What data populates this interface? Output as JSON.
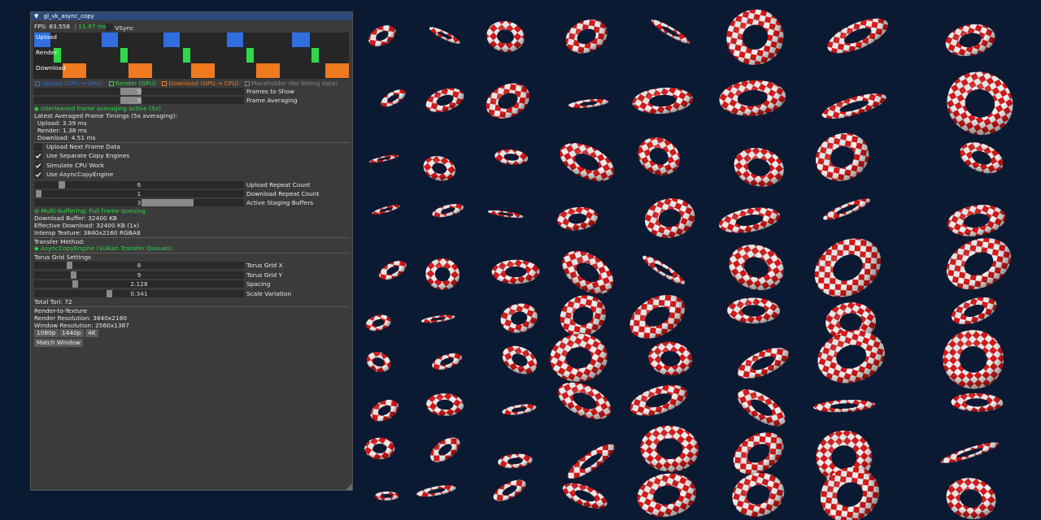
{
  "window": {
    "title": "gl_vk_async_copy"
  },
  "stats": {
    "fps": "FPS: 83.558",
    "frame_ms": "| 11.97 ms",
    "vsync_label": "VSync"
  },
  "timeline": {
    "lanes": [
      "Upload",
      "Render",
      "Download"
    ],
    "legend": [
      {
        "label": "Upload (CPU → GPU)",
        "color": "#2f6fe0"
      },
      {
        "label": "Render (GPU)",
        "color": "#2ed84a"
      },
      {
        "label": "Download (GPU → CPU)",
        "color": "#f07a20"
      },
      {
        "label": "Placeholder (No timing data)",
        "color": "#888888"
      }
    ]
  },
  "frames_to_show": {
    "value": "5",
    "label": "Frames to Show"
  },
  "frame_averaging": {
    "value": "5",
    "label": "Frame Averaging"
  },
  "averaging_status": "Interleaved frame averaging active (5x)",
  "timings": {
    "heading": "Latest Averaged Frame Timings (5x averaging):",
    "upload": "Upload: 3.39 ms",
    "render": "Render: 1.38 ms",
    "download": "Download: 4.51 ms"
  },
  "checkboxes": [
    {
      "label": "Upload Next Frame Data",
      "checked": false
    },
    {
      "label": "Use Separate Copy Engines",
      "checked": true
    },
    {
      "label": "Simulate CPU Work",
      "checked": true
    },
    {
      "label": "Use AsyncCopyEngine",
      "checked": true
    }
  ],
  "upload_repeat": {
    "value": "6",
    "label": "Upload Repeat Count"
  },
  "download_repeat": {
    "value": "1",
    "label": "Download Repeat Count"
  },
  "staging_buffers": {
    "value": "3",
    "label": "Active Staging Buffers"
  },
  "buffering_status": "Multi-buffering: Full frame queuing",
  "buffer_info": {
    "download_buffer": "Download Buffer: 32400 KB",
    "effective_download": "Effective Download: 32400 KB (1x)",
    "interop_texture": "Interop Texture: 3840x2160 RGBA8"
  },
  "transfer": {
    "heading": "Transfer Method:",
    "method": "AsyncCopyEngine (Vulkan Transfer Queues)"
  },
  "torus": {
    "heading": "Torus Grid Settings",
    "grid_x": {
      "value": "8",
      "label": "Torus Grid X"
    },
    "grid_y": {
      "value": "9",
      "label": "Torus Grid Y"
    },
    "spacing": {
      "value": "2.128",
      "label": "Spacing"
    },
    "scale_variation": {
      "value": "0.341",
      "label": "Scale Variation"
    },
    "total": "Total Tori: 72"
  },
  "render_target": {
    "heading": "Render-to-Texture",
    "render_resolution": "Render Resolution: 3840x2160",
    "window_resolution": "Window Resolution: 2560x1387",
    "buttons": [
      "1080p",
      "1440p",
      "4K"
    ],
    "match_button": "Match Window"
  },
  "colors": {
    "background": "#0a1a33",
    "torus_red": "#d81818",
    "torus_white": "#f2f2f2",
    "accent_green": "#2ed84a"
  }
}
